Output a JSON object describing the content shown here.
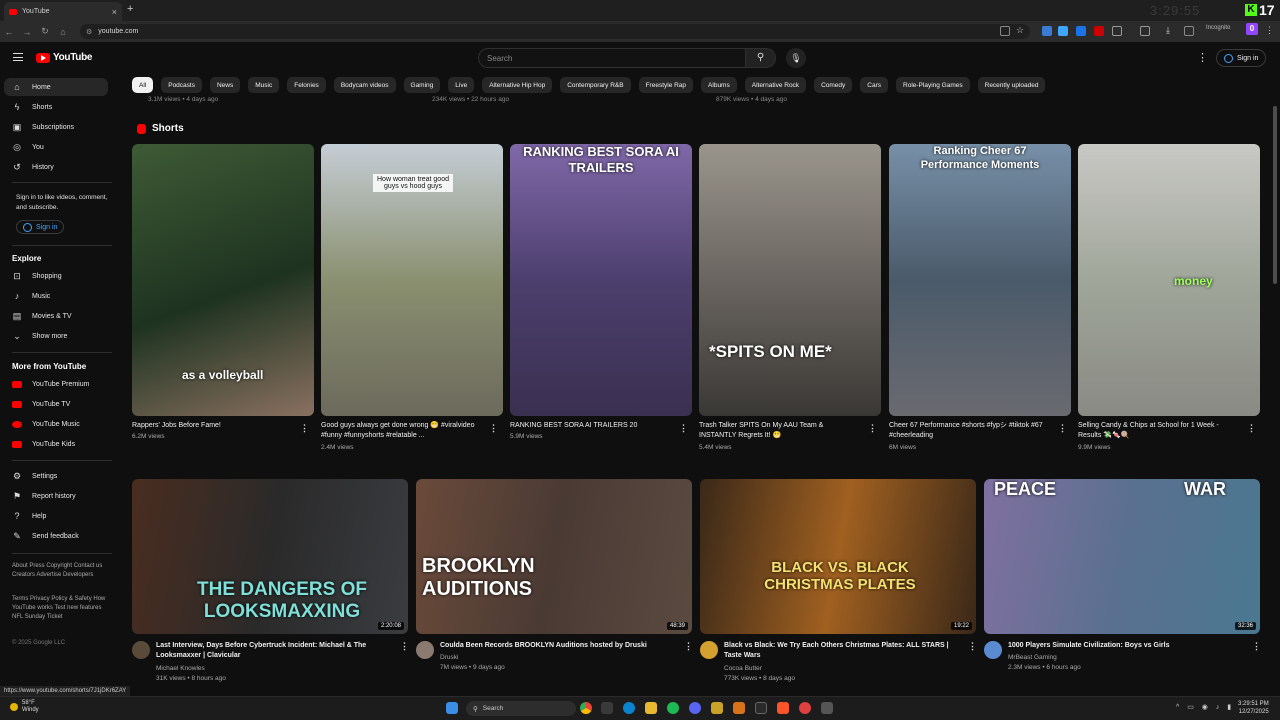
{
  "browser": {
    "tab_title": "YouTube",
    "tab_close": "×",
    "new_tab": "+",
    "url": "youtube.com",
    "clock_ghost": "3:29:55",
    "kick_count": "17",
    "kick_badge": "0",
    "incognito": "Incognito"
  },
  "header": {
    "logo": "YouTube",
    "search_placeholder": "Search",
    "signin": "Sign in"
  },
  "sidebar": {
    "main": [
      {
        "label": "Home",
        "icon": "home-icon"
      },
      {
        "label": "Shorts",
        "icon": "shorts-icon"
      },
      {
        "label": "Subscriptions",
        "icon": "subscriptions-icon"
      },
      {
        "label": "You",
        "icon": "you-icon"
      },
      {
        "label": "History",
        "icon": "history-icon"
      }
    ],
    "signin_prompt": "Sign in to like videos, comment, and subscribe.",
    "signin_button": "Sign in",
    "explore_heading": "Explore",
    "explore": [
      {
        "label": "Shopping"
      },
      {
        "label": "Music"
      },
      {
        "label": "Movies & TV"
      },
      {
        "label": "Show more"
      }
    ],
    "more_heading": "More from YouTube",
    "more": [
      {
        "label": "YouTube Premium"
      },
      {
        "label": "YouTube TV"
      },
      {
        "label": "YouTube Music"
      },
      {
        "label": "YouTube Kids"
      }
    ],
    "settings": [
      {
        "label": "Settings"
      },
      {
        "label": "Report history"
      },
      {
        "label": "Help"
      },
      {
        "label": "Send feedback"
      }
    ],
    "footer1": "About  Press  Copyright  Contact us  Creators  Advertise  Developers",
    "footer2": "Terms  Privacy  Policy & Safety  How YouTube works  Test new features  NFL Sunday Ticket",
    "copyright": "© 2025 Google LLC"
  },
  "chips": [
    "All",
    "Podcasts",
    "News",
    "Music",
    "Felonies",
    "Bodycam videos",
    "Gaming",
    "Live",
    "Alternative Hip Hop",
    "Contemporary R&B",
    "Freestyle Rap",
    "Albums",
    "Alternative Rock",
    "Comedy",
    "Cars",
    "Role-Playing Games",
    "Recently uploaded"
  ],
  "prev_row": [
    "3.1M views • 4 days ago",
    "234K views • 22 hours ago",
    "879K views • 4 days ago"
  ],
  "shorts_heading": "Shorts",
  "shorts": [
    {
      "title": "Rappers' Jobs Before Fame!",
      "views": "6.2M views",
      "overlay": "as a volleyball"
    },
    {
      "title": "Good guys always get done wrong 😁 #viralvideo #funny #funnyshorts #relatable ...",
      "views": "2.4M views",
      "overlay": "How woman treat good guys vs hood guys"
    },
    {
      "title": "RANKING BEST SORA AI TRAILERS 20",
      "views": "5.9M views",
      "overlay": "RANKING BEST SORA AI TRAILERS"
    },
    {
      "title": "Trash Talker SPITS On My AAU Team & INSTANTLY Regrets It! 😬",
      "views": "5.4M views",
      "overlay": "*SPITS ON ME*"
    },
    {
      "title": "Cheer 67 Performance #shorts #fypシ #tiktok #67 #cheerleading",
      "views": "6M views",
      "overlay": "Ranking Cheer 67 Performance Moments"
    },
    {
      "title": "Selling Candy & Chips at School for 1 Week - Results 💸🍬🍭",
      "views": "9.9M views",
      "overlay": "money"
    }
  ],
  "videos": [
    {
      "title": "Last Interview, Days Before Cybertruck Incident: Michael & The Looksmaxxer | Clavicular",
      "channel": "Michael Knowles",
      "meta": "31K views • 8 hours ago",
      "duration": "2:20:08",
      "overlay": "THE DANGERS OF LOOKSMAXXING"
    },
    {
      "title": "Coulda Been Records BROOKLYN Auditions hosted by Druski",
      "channel": "Druski",
      "meta": "7M views • 9 days ago",
      "duration": "48:39",
      "overlay": "BROOKLYN AUDITIONS"
    },
    {
      "title": "Black vs Black: We Try Each Others Christmas Plates: ALL STARS | Taste Wars",
      "channel": "Cocoa Butter",
      "meta": "773K views • 8 days ago",
      "duration": "19:22",
      "overlay": "BLACK VS. BLACK CHRISTMAS PLATES"
    },
    {
      "title": "1000 Players Simulate Civilization: Boys vs Girls",
      "channel": "MrBeast Gaming",
      "meta": "2.3M views • 6 hours ago",
      "duration": "32:36",
      "overlay_left": "PEACE",
      "overlay_right": "WAR"
    }
  ],
  "status_url": "https://www.youtube.com/shorts/7J1jDKr6ZAY",
  "taskbar": {
    "temp": "58°F",
    "weather": "Windy",
    "search": "Search",
    "time": "3:29:51 PM",
    "date": "12/27/2025"
  }
}
